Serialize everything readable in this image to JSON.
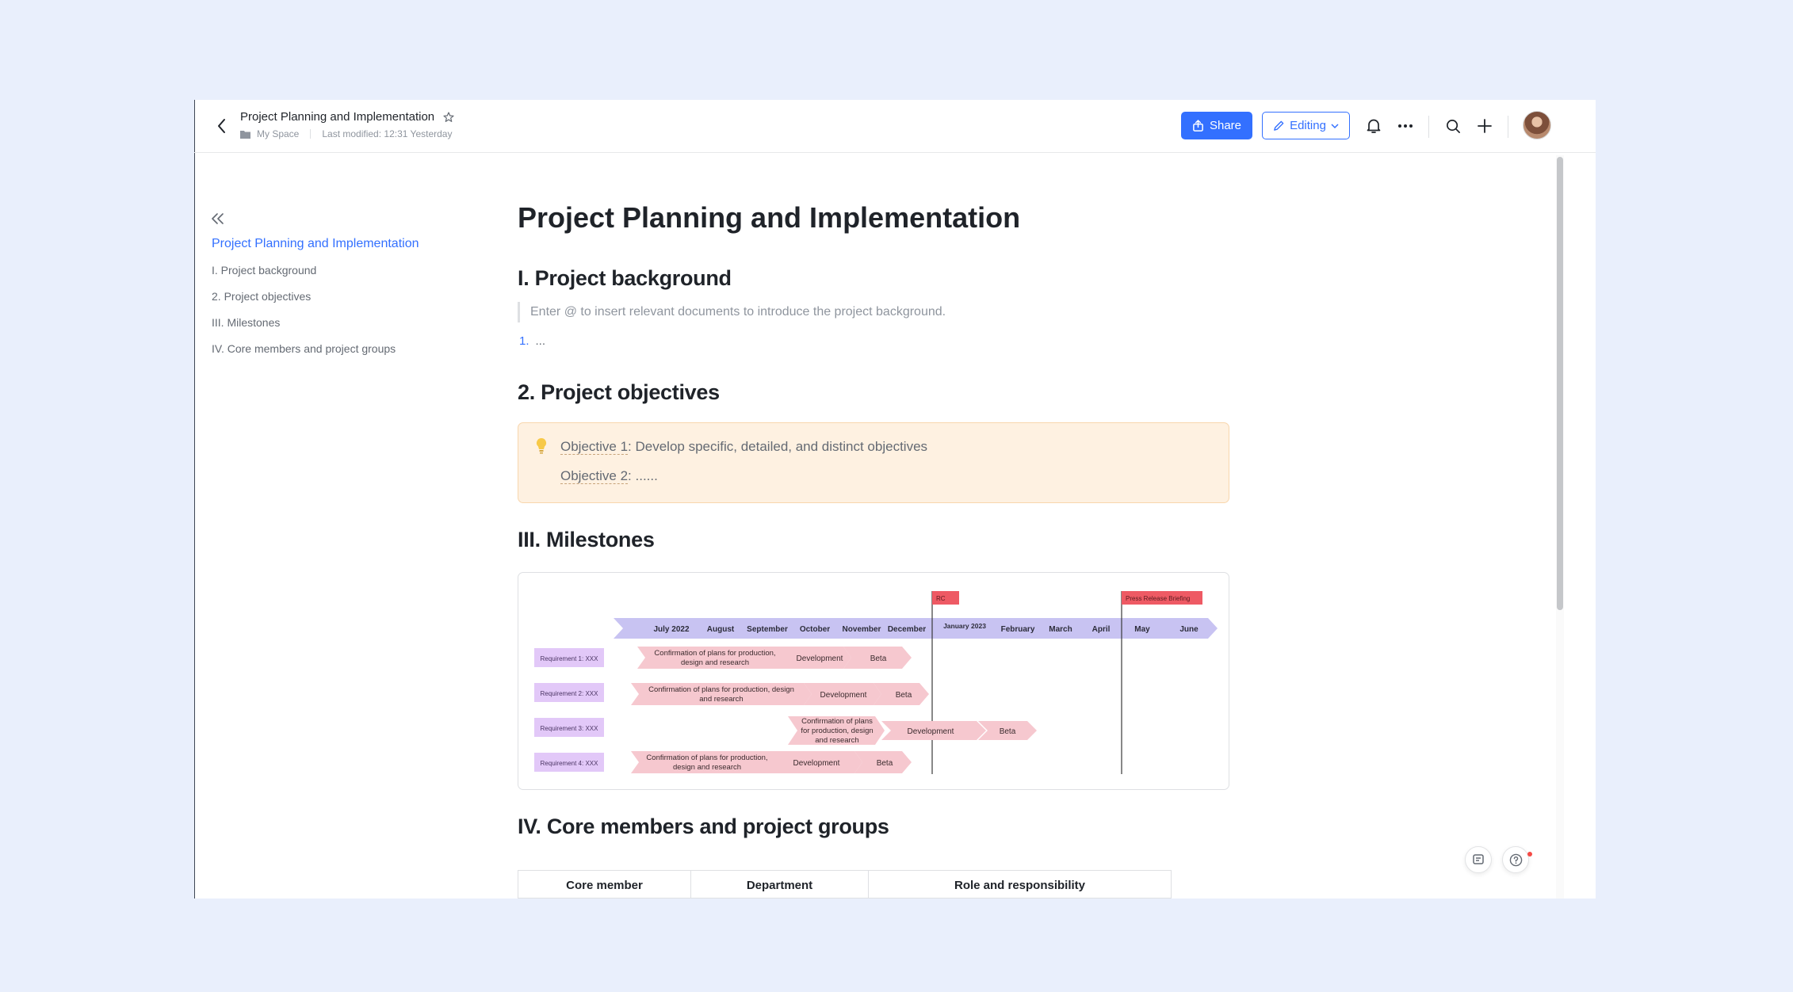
{
  "header": {
    "title": "Project Planning and Implementation",
    "space": "My Space",
    "last_modified": "Last modified: 12:31 Yesterday",
    "share_label": "Share",
    "editing_label": "Editing"
  },
  "outline": {
    "items": [
      {
        "label": "Project Planning and Implementation",
        "active": true
      },
      {
        "label": "I. Project background"
      },
      {
        "label": "2. Project objectives"
      },
      {
        "label": "III. Milestones"
      },
      {
        "label": "IV. Core members and project groups"
      }
    ]
  },
  "doc": {
    "title": "Project Planning and Implementation",
    "sections": {
      "background": {
        "heading": "I. Project background",
        "quote": "Enter @ to insert relevant documents to introduce the project background.",
        "list_number": "1.",
        "list_text": "..."
      },
      "objectives": {
        "heading": "2. Project objectives",
        "obj1_label": "Objective 1",
        "obj1_text": ": Develop specific, detailed, and distinct objectives",
        "obj2_label": "Objective 2",
        "obj2_text": ": ......"
      },
      "milestones": {
        "heading": "III. Milestones"
      },
      "members": {
        "heading": "IV. Core members and project groups",
        "columns": [
          "Core member",
          "Department",
          "Role and responsibility"
        ]
      }
    }
  },
  "gantt": {
    "months": [
      "July 2022",
      "August",
      "September",
      "October",
      "November",
      "December",
      "January 2023",
      "February",
      "March",
      "April",
      "May",
      "June"
    ],
    "flags": [
      "RC",
      "Press Release Briefing"
    ],
    "rows": [
      {
        "label": "Requirement 1: XXX",
        "tasks": [
          "Confirmation of plans for production, design and research",
          "Development",
          "Beta"
        ]
      },
      {
        "label": "Requirement 2: XXX",
        "tasks": [
          "Confirmation of plans for production, design and research",
          "Development",
          "Beta"
        ]
      },
      {
        "label": "Requirement 3: XXX",
        "tasks": [
          "Confirmation of plans for production, design and research",
          "Development",
          "Beta"
        ]
      },
      {
        "label": "Requirement 4: XXX",
        "tasks": [
          "Confirmation of plans for production, design and research",
          "Development",
          "Beta"
        ]
      }
    ]
  },
  "colors": {
    "accent": "#3370ff",
    "callout_bg": "#fef1e1",
    "timeline": "#c8c3f2",
    "task": "#f6c8cf",
    "requirement": "#e2c8f8",
    "flag": "#ee5a64"
  },
  "icons": [
    "chevron-left-icon",
    "star-icon",
    "folder-icon",
    "share-icon",
    "pencil-icon",
    "chevron-down-icon",
    "bell-icon",
    "more-icon",
    "search-icon",
    "plus-icon",
    "double-chevron-left-icon",
    "lightbulb-icon",
    "comment-icon",
    "help-icon"
  ]
}
